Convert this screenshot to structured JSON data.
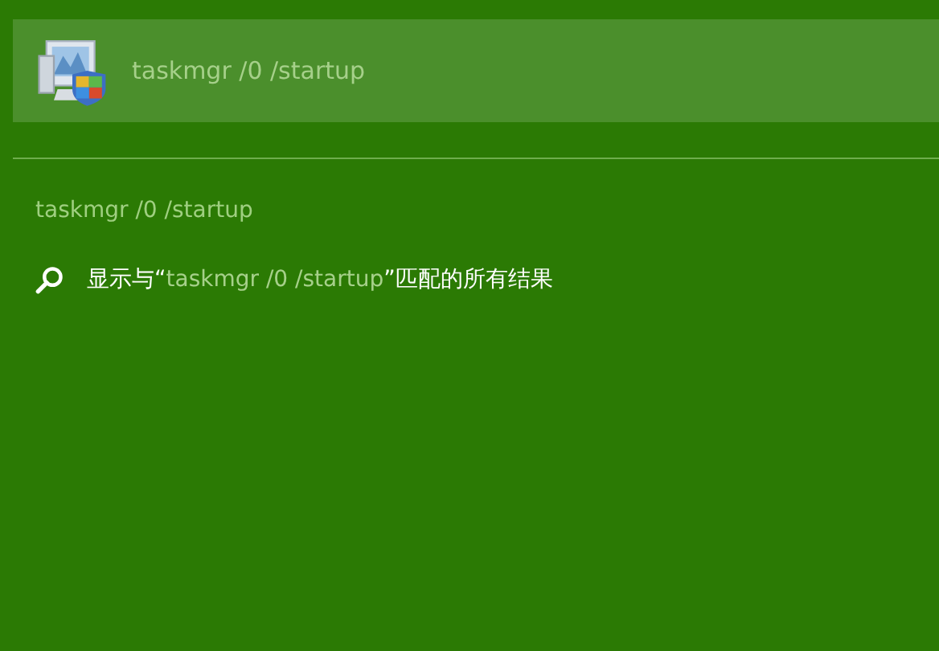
{
  "top_result": {
    "title": "taskmgr /0 /startup",
    "selected": true
  },
  "query_heading": "taskmgr /0 /startup",
  "all_results": {
    "prefix": "显示与“",
    "query": "taskmgr /0 /startup",
    "suffix": "”匹配的所有结果"
  }
}
